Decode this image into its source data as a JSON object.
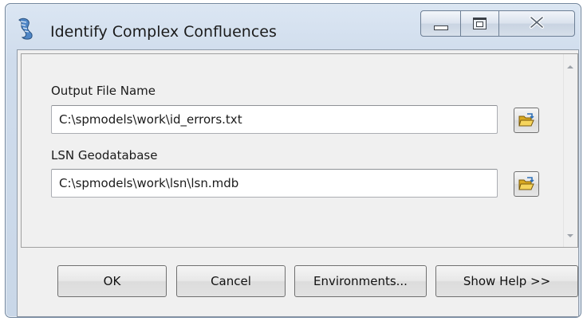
{
  "window": {
    "title": "Identify Complex Confluences"
  },
  "form": {
    "output_label": "Output File Name",
    "output_value": "C:\\spmodels\\work\\id_errors.txt",
    "lsn_label": "LSN Geodatabase",
    "lsn_value": "C:\\spmodels\\work\\lsn\\lsn.mdb"
  },
  "buttons": {
    "ok": "OK",
    "cancel": "Cancel",
    "environments": "Environments...",
    "show_help": "Show Help >>"
  },
  "icons": {
    "title": "script-tool-icon",
    "minimize": "minimize-icon",
    "maximize": "maximize-icon",
    "close": "close-icon",
    "browse": "open-folder-icon"
  },
  "colors": {
    "titlebar": "#cfdcec",
    "client": "#f0f0f0",
    "folder": "#e8c341"
  }
}
